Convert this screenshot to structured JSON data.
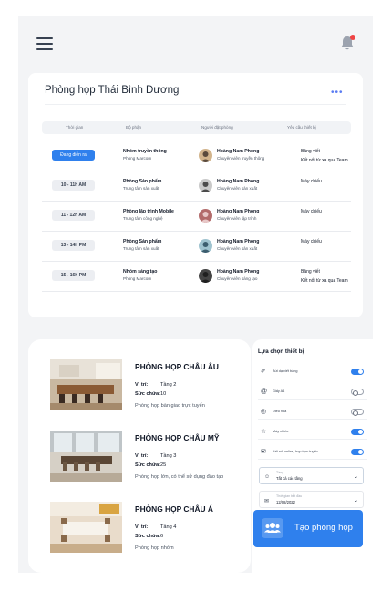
{
  "header": {
    "menu_icon": "hamburger-menu-icon",
    "notification_icon": "bell-icon",
    "notification_dot_color": "#ef4444"
  },
  "schedule": {
    "title": "Phòng họp Thái Bình Dương",
    "more_label": "•••",
    "columns": [
      "Thời gian",
      "Bộ phận",
      "Người đặt phòng",
      "Yêu cầu thiết bị"
    ],
    "rows": [
      {
        "time": "Đang diễn ra",
        "active": true,
        "dept": "Nhóm truyền thông",
        "dept_sub": "Phòng Marcom",
        "person": "Hoàng Nam Phong",
        "role": "Chuyên viên truyền thông",
        "req": [
          "Bảng viết",
          "Kết nối từ xa qua Team"
        ]
      },
      {
        "time": "10 - 11h AM",
        "active": false,
        "dept": "Phòng Sản phẩm",
        "dept_sub": "Trung tâm sản xuất",
        "person": "Hoàng Nam Phong",
        "role": "Chuyên viên sản xuất",
        "req": [
          "Máy chiếu"
        ]
      },
      {
        "time": "11 - 12h AM",
        "active": false,
        "dept": "Phòng lập trình Mobile",
        "dept_sub": "Trung tâm công nghệ",
        "person": "Hoàng Nam Phong",
        "role": "Chuyên viên lập trình",
        "req": [
          "Máy chiếu"
        ]
      },
      {
        "time": "13 - 14h PM",
        "active": false,
        "dept": "Phòng Sản phẩm",
        "dept_sub": "Trung tâm sản xuất",
        "person": "Hoàng Nam Phong",
        "role": "Chuyên viên sản xuất",
        "req": [
          "Máy chiếu"
        ]
      },
      {
        "time": "15 - 16h PM",
        "active": false,
        "dept": "Nhóm sáng tạo",
        "dept_sub": "Phòng Marcom",
        "person": "Hoàng Nam Phong",
        "role": "Chuyên viên sáng tạo",
        "req": [
          "Bảng viết",
          "Kết nối từ xa qua Team"
        ]
      }
    ]
  },
  "rooms": [
    {
      "name": "PHÒNG HỌP CHÂU ÂU",
      "location_label": "Vị trí:",
      "location": "Tầng 2",
      "capacity_label": "Sức chứa:",
      "capacity": "10",
      "desc": "Phòng họp bàn giao trực tuyến"
    },
    {
      "name": "PHÒNG HỌP CHÂU MỸ",
      "location_label": "Vị trí:",
      "location": "Tầng 3",
      "capacity_label": "Sức chứa:",
      "capacity": "25",
      "desc": "Phòng họp lớn, có thể sử dụng đào tạo"
    },
    {
      "name": "PHÒNG HỌP CHÂU Á",
      "location_label": "Vị trí:",
      "location": "Tầng 4",
      "capacity_label": "Sức chứa:",
      "capacity": "6",
      "desc": "Phòng họp nhóm"
    }
  ],
  "equipment": {
    "title": "Lựa chọn thiết bị",
    "items": [
      {
        "label": "Bút dạ viết bảng",
        "icon": "marker-icon",
        "on": true
      },
      {
        "label": "Giấy A4",
        "icon": "paper-icon",
        "on": false
      },
      {
        "label": "Điều hòa",
        "icon": "air-conditioner-icon",
        "on": false
      },
      {
        "label": "Máy chiếu",
        "icon": "projector-icon",
        "on": true
      },
      {
        "label": "Kết nối online, họp trực tuyến",
        "icon": "online-meeting-icon",
        "on": true
      }
    ]
  },
  "form": {
    "floor_label": "Tầng",
    "floor_value": "Tất cả các tầng",
    "date_label": "Thời gian bắt đầu",
    "date_value": "12/08/2022"
  },
  "cta": {
    "label": "Tạo phòng họp",
    "icon": "people-icon"
  },
  "colors": {
    "primary": "#2f80ed",
    "page_bg": "#f3f4f6"
  }
}
